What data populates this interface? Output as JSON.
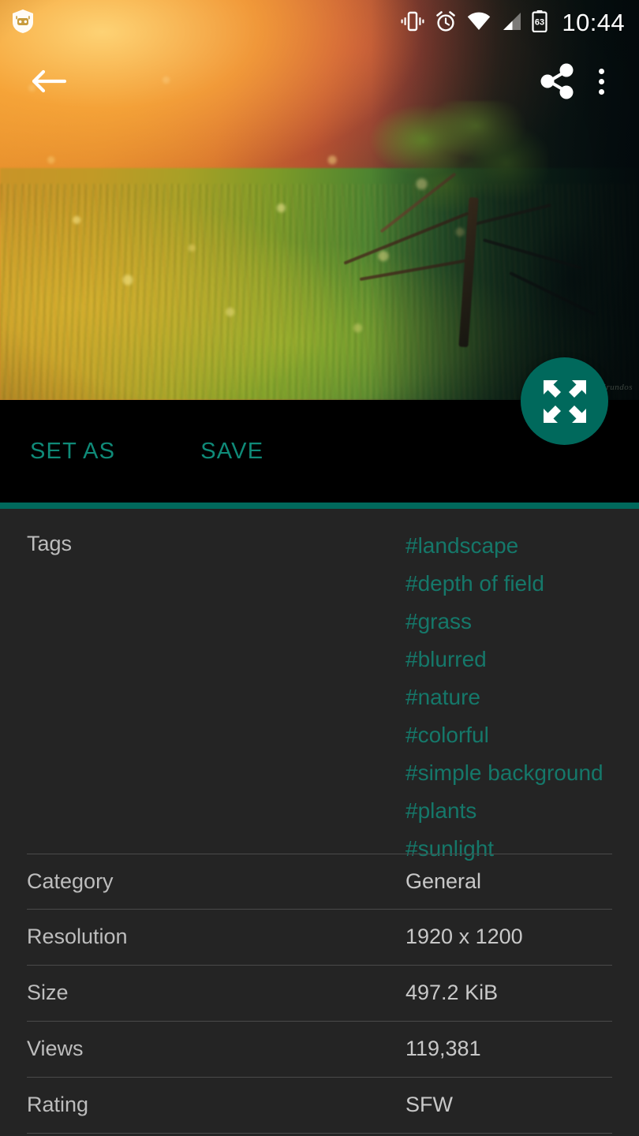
{
  "status_bar": {
    "left_icon": "shield-robot-icon",
    "icons": [
      "vibrate-icon",
      "alarm-icon",
      "wifi-icon",
      "cellular-signal-icon",
      "battery-icon"
    ],
    "battery_level": "63",
    "time": "10:44"
  },
  "app_bar": {
    "back_label": "back-arrow-icon",
    "share_label": "share-icon",
    "overflow_label": "more-options-icon"
  },
  "hero": {
    "watermark": "hirundos",
    "fab_label": "fullscreen-expand-icon"
  },
  "actions": {
    "set_as_label": "SET AS",
    "save_label": "SAVE"
  },
  "details": {
    "tags_label": "Tags",
    "tags": [
      "#landscape",
      "#depth of field",
      "#grass",
      "#blurred",
      "#nature",
      "#colorful",
      "#simple background",
      "#plants",
      "#sunlight"
    ],
    "rows": [
      {
        "label": "Category",
        "value": "General"
      },
      {
        "label": "Resolution",
        "value": "1920 x 1200"
      },
      {
        "label": "Size",
        "value": "497.2 KiB"
      },
      {
        "label": "Views",
        "value": "119,381"
      },
      {
        "label": "Rating",
        "value": "SFW"
      }
    ]
  },
  "colors": {
    "accent": "#00695c",
    "tag_text": "#15786a",
    "action_text": "#0f8a78",
    "panel_bg": "#242424",
    "label_text": "#bdbdbd"
  }
}
